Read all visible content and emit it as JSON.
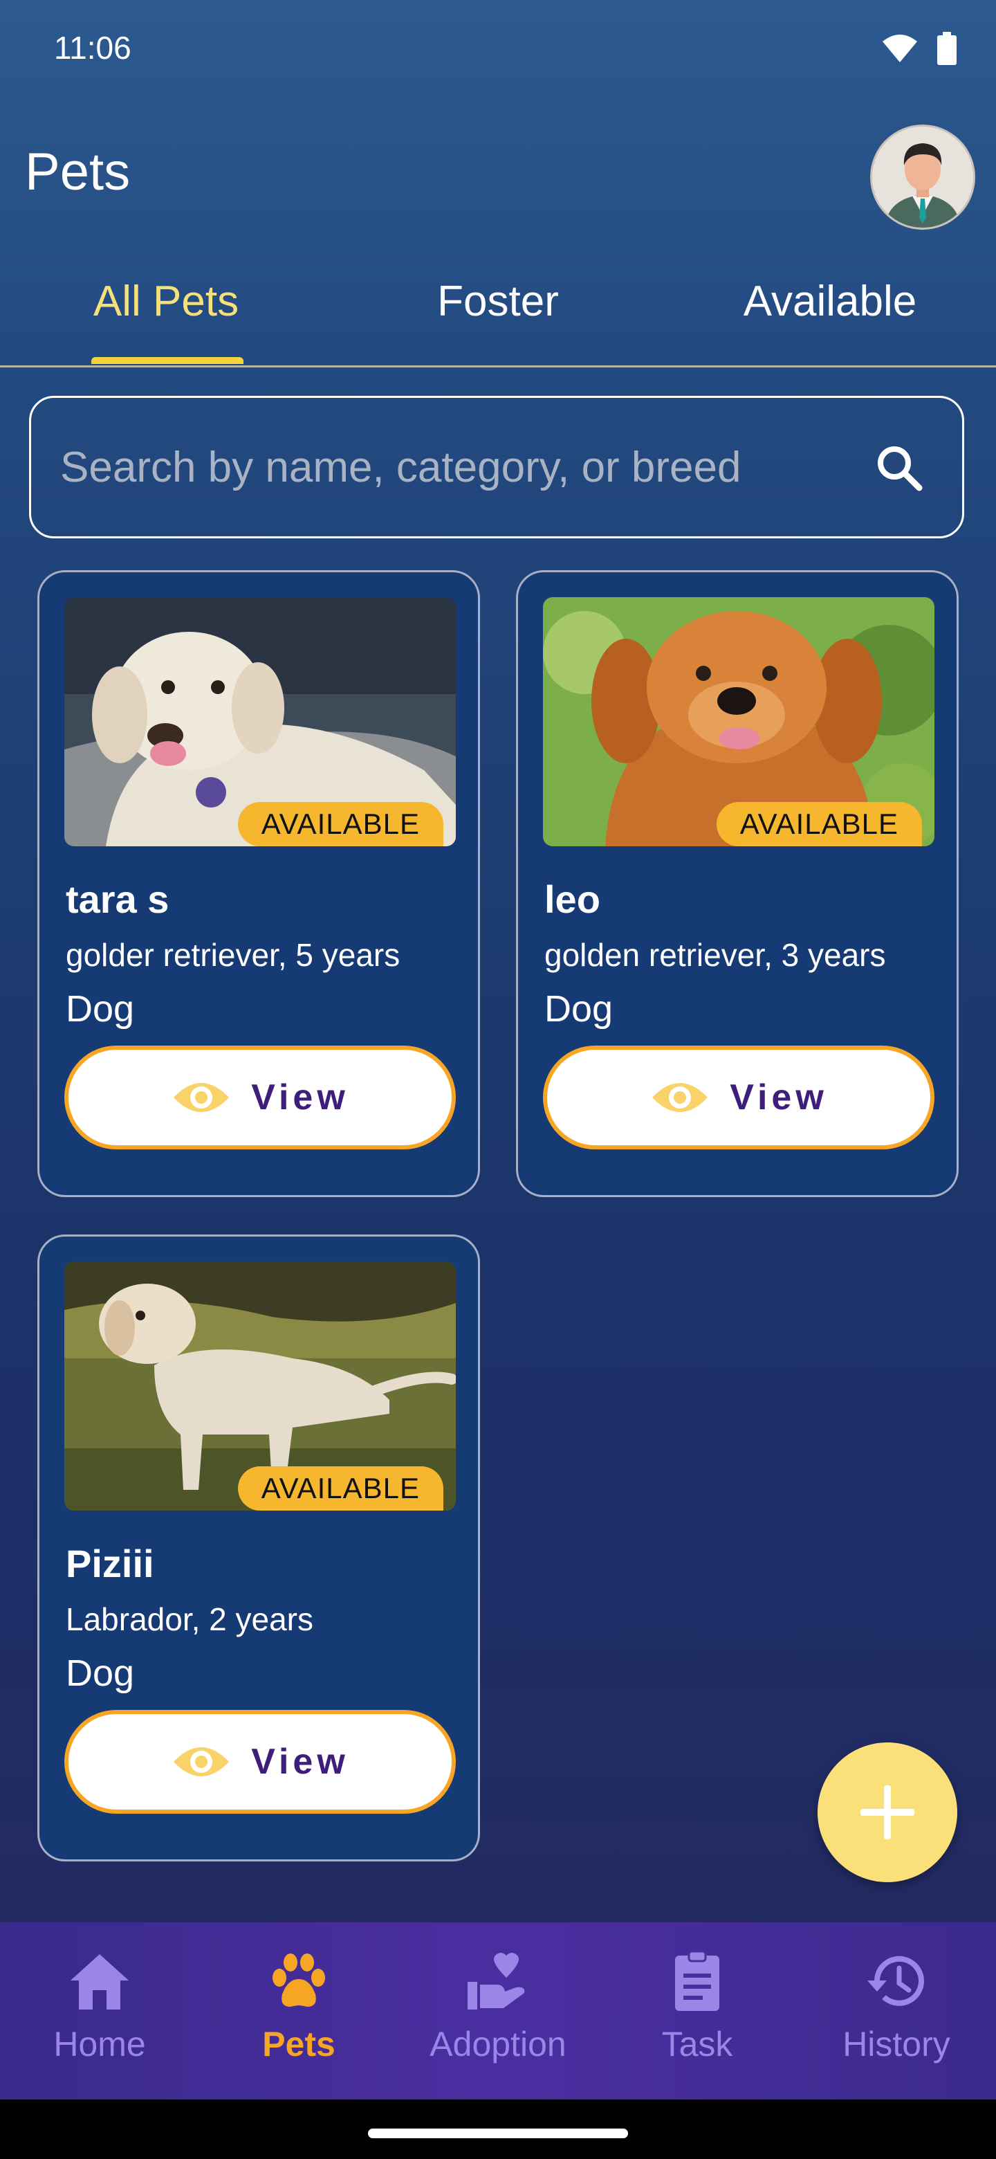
{
  "status_bar": {
    "time": "11:06"
  },
  "header": {
    "title": "Pets"
  },
  "tabs": [
    {
      "label": "All Pets",
      "active": true
    },
    {
      "label": "Foster",
      "active": false
    },
    {
      "label": "Available",
      "active": false
    }
  ],
  "search": {
    "placeholder": "Search by name, category, or breed",
    "value": ""
  },
  "pets": [
    {
      "name": "tara s",
      "breed_age": "golder retriever, 5 years",
      "category": "Dog",
      "status": "AVAILABLE",
      "view_label": "View"
    },
    {
      "name": "leo",
      "breed_age": "golden retriever, 3 years",
      "category": "Dog",
      "status": "AVAILABLE",
      "view_label": "View"
    },
    {
      "name": "Piziii",
      "breed_age": "Labrador, 2 years",
      "category": "Dog",
      "status": "AVAILABLE",
      "view_label": "View"
    }
  ],
  "bottom_nav": [
    {
      "label": "Home",
      "icon": "home-icon",
      "active": false
    },
    {
      "label": "Pets",
      "icon": "paw-icon",
      "active": true
    },
    {
      "label": "Adoption",
      "icon": "adoption-icon",
      "active": false
    },
    {
      "label": "Task",
      "icon": "clipboard-icon",
      "active": false
    },
    {
      "label": "History",
      "icon": "history-icon",
      "active": false
    }
  ],
  "colors": {
    "accent": "#f6d33b",
    "badge": "#f6b72e",
    "button_border": "#f6a524",
    "button_text": "#3e1e7a",
    "fab": "#fbe07a",
    "nav_inactive": "#9a86e6",
    "nav_active": "#f6a524"
  }
}
